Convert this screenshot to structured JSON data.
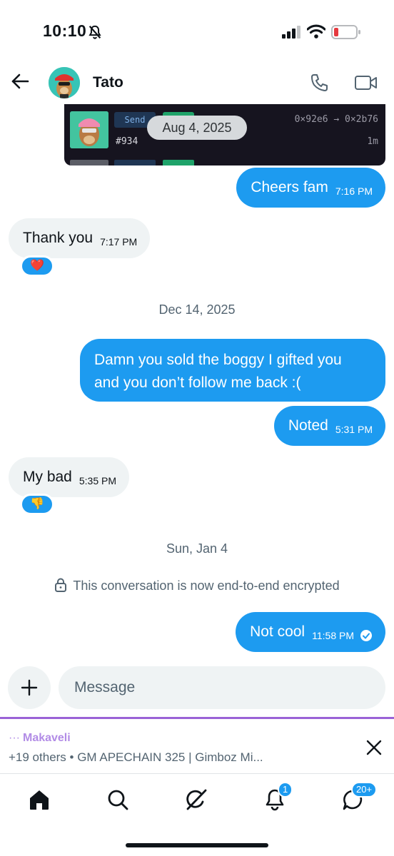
{
  "status_bar": {
    "time": "10:10",
    "icons": [
      "bell-slash-icon",
      "signal-icon",
      "wifi-icon",
      "battery-low-icon"
    ]
  },
  "header": {
    "contact_name": "Tato",
    "icons": [
      "back-arrow-icon",
      "avatar",
      "phone-icon",
      "video-icon"
    ]
  },
  "nft_card": {
    "action": "Send",
    "token_id": "#934",
    "transfer": "0×92e6 → 0×2b76",
    "age": "1m"
  },
  "floating_date": "Aug 4, 2025",
  "messages": [
    {
      "direction": "out",
      "text": "Cheers fam",
      "time": "7:16 PM"
    },
    {
      "direction": "in",
      "text": "Thank you",
      "time": "7:17 PM",
      "reaction": "❤️"
    },
    {
      "direction": "separator",
      "text": "Dec 14, 2025"
    },
    {
      "direction": "out",
      "lines": [
        "Damn you sold the boggy I gifted you",
        "and you don’t follow me back :("
      ]
    },
    {
      "direction": "out",
      "text": "Noted",
      "time": "5:31 PM"
    },
    {
      "direction": "in",
      "text": "My bad",
      "time": "5:35 PM",
      "reaction": "👎"
    },
    {
      "direction": "separator",
      "text": "Sun, Jan 4"
    },
    {
      "direction": "out",
      "text": "Not cool",
      "time": "11:58 PM",
      "status": "read"
    }
  ],
  "encryption_notice": "This conversation is now end-to-end encrypted",
  "composer": {
    "placeholder": "Message"
  },
  "notification": {
    "prefix": "···",
    "sender": "Makaveli",
    "text": "+19 others • GM APECHAIN 325 | Gimboz Mi..."
  },
  "bottom_nav": {
    "items": [
      "home-icon",
      "search-icon",
      "grok-icon",
      "notifications-icon",
      "messages-icon"
    ],
    "notifications_badge": "1",
    "messages_badge": "20+"
  },
  "colors": {
    "accent": "#1d9bf0",
    "incoming_bubble": "#eff3f4",
    "notification_accent": "#9a62d6"
  }
}
